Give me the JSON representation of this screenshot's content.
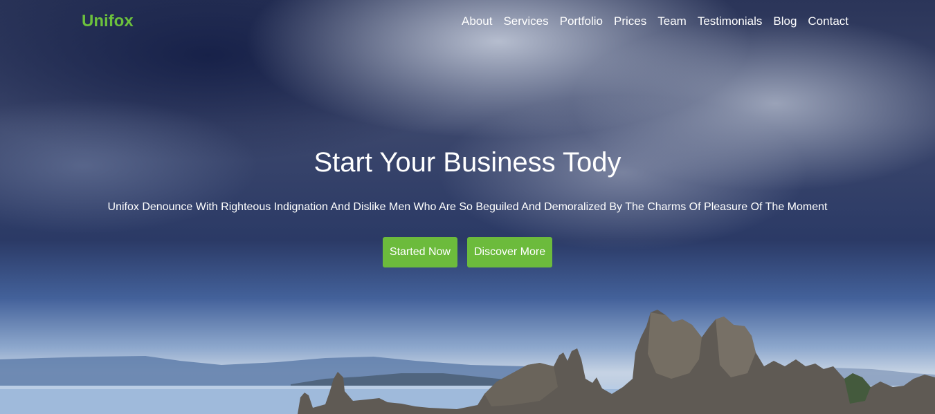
{
  "brand": {
    "name": "Unifox",
    "color": "#6cc13d"
  },
  "nav": {
    "items": [
      {
        "label": "About"
      },
      {
        "label": "Services"
      },
      {
        "label": "Portfolio"
      },
      {
        "label": "Prices"
      },
      {
        "label": "Team"
      },
      {
        "label": "Testimonials"
      },
      {
        "label": "Blog"
      },
      {
        "label": "Contact"
      }
    ]
  },
  "hero": {
    "title": "Start Your Business Tody",
    "subtitle": "Unifox Denounce With Righteous Indignation And Dislike Men Who Are So Beguiled And Demoralized By The Charms Of Pleasure Of The Moment",
    "primary_button": "Started Now",
    "secondary_button": "Discover More",
    "button_color": "#6cbb3c"
  }
}
